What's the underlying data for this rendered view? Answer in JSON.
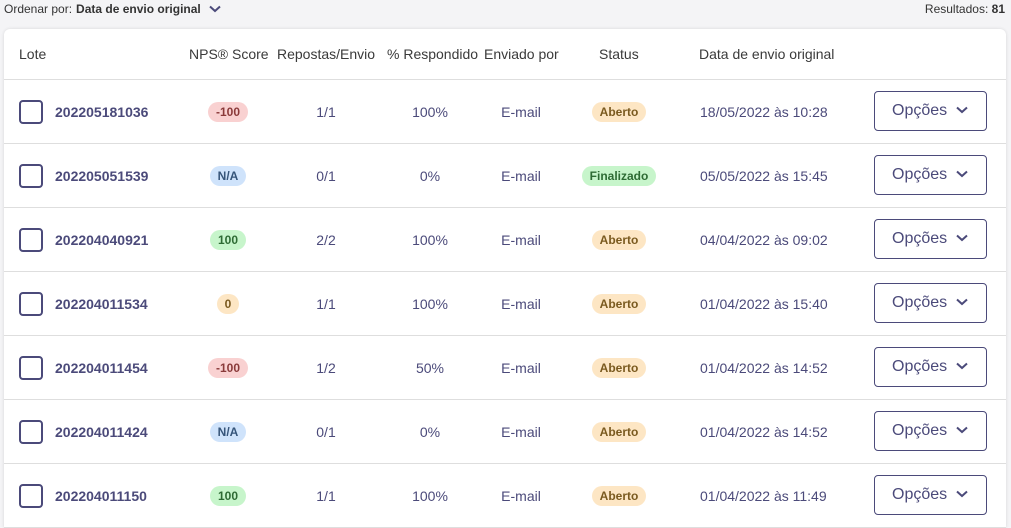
{
  "toolbar": {
    "sort_label": "Ordenar por:",
    "sort_value": "Data de envio original",
    "results_label": "Resultados:",
    "results_count": "81"
  },
  "table": {
    "headers": {
      "lote": "Lote",
      "nps": "NPS® Score",
      "respostas": "Repostas/Envio",
      "respondido": "% Respondido",
      "enviado": "Enviado por",
      "status": "Status",
      "data": "Data de envio original"
    },
    "options_label": "Opções",
    "rows": [
      {
        "lote": "202205181036",
        "nps": "-100",
        "nps_color": "red",
        "respostas": "1/1",
        "respondido": "100%",
        "enviado": "E-mail",
        "status": "Aberto",
        "status_kind": "aberto",
        "data": "18/05/2022 às 10:28"
      },
      {
        "lote": "202205051539",
        "nps": "N/A",
        "nps_color": "blue",
        "respostas": "0/1",
        "respondido": "0%",
        "enviado": "E-mail",
        "status": "Finalizado",
        "status_kind": "final",
        "data": "05/05/2022 às 15:45"
      },
      {
        "lote": "202204040921",
        "nps": "100",
        "nps_color": "green",
        "respostas": "2/2",
        "respondido": "100%",
        "enviado": "E-mail",
        "status": "Aberto",
        "status_kind": "aberto",
        "data": "04/04/2022 às 09:02"
      },
      {
        "lote": "202204011534",
        "nps": "0",
        "nps_color": "yellow",
        "respostas": "1/1",
        "respondido": "100%",
        "enviado": "E-mail",
        "status": "Aberto",
        "status_kind": "aberto",
        "data": "01/04/2022 às 15:40"
      },
      {
        "lote": "202204011454",
        "nps": "-100",
        "nps_color": "red",
        "respostas": "1/2",
        "respondido": "50%",
        "enviado": "E-mail",
        "status": "Aberto",
        "status_kind": "aberto",
        "data": "01/04/2022 às 14:52"
      },
      {
        "lote": "202204011424",
        "nps": "N/A",
        "nps_color": "blue",
        "respostas": "0/1",
        "respondido": "0%",
        "enviado": "E-mail",
        "status": "Aberto",
        "status_kind": "aberto",
        "data": "01/04/2022 às 14:52"
      },
      {
        "lote": "202204011150",
        "nps": "100",
        "nps_color": "green",
        "respostas": "1/1",
        "respondido": "100%",
        "enviado": "E-mail",
        "status": "Aberto",
        "status_kind": "aberto",
        "data": "01/04/2022 às 11:49"
      }
    ]
  },
  "colors": {
    "accent": "#4b4a7a",
    "badge_red": "#f9d1d1",
    "badge_blue": "#cfe3fb",
    "badge_green": "#c7f5cb",
    "badge_yellow": "#fde6c4"
  },
  "icons": {
    "sort_chevron": "chevron-down-icon",
    "options_chevron": "chevron-down-icon"
  }
}
